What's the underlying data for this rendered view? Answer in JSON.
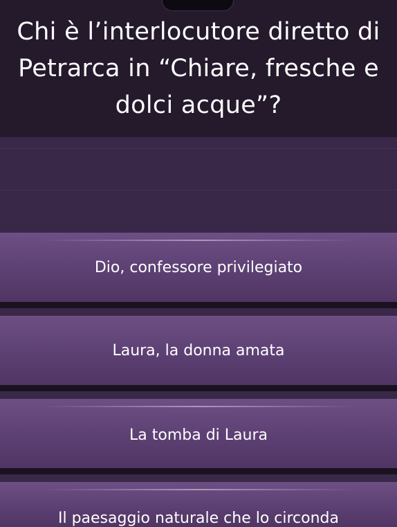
{
  "quiz": {
    "question": "Chi è l’interlocutore diretto di Petrarca in “Chiare, fresche e dolci acque”?",
    "answers": [
      {
        "label": "Dio, confessore privilegiato"
      },
      {
        "label": "Laura, la donna amata"
      },
      {
        "label": "La tomba di Laura"
      },
      {
        "label": "Il paesaggio naturale che lo circonda"
      }
    ]
  },
  "colors": {
    "background": "#2b1d35",
    "question_bg": "#241a2c",
    "answer_top": "#6e4f84",
    "answer_bottom": "#4f3564",
    "text": "#ffffff"
  }
}
